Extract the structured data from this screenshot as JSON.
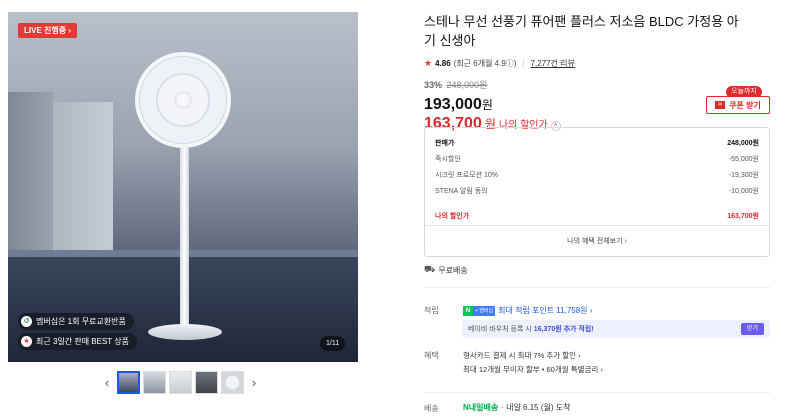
{
  "media": {
    "live_badge": "LIVE 진행중",
    "chip1": "멤버십은 1회 무료교환반품",
    "chip2": "최근 3일간 판매 BEST 상품",
    "counter": "1/11",
    "prev_arrow": "‹",
    "next_arrow": "›"
  },
  "product": {
    "title": "스테나 무선 선풍기 퓨어팬 플러스 저소음 BLDC 가정용 아기 신생아",
    "rating": "4.86",
    "rating_detail": "(최근 6개월 4.9ⓘ)",
    "reviews": "7,277건 리뷰",
    "discount_pct": "33%",
    "original_price": "248,000원",
    "price": "193,000",
    "price_unit": "원",
    "my_price": "163,700",
    "my_price_unit": "원",
    "my_price_label": "나의 할인가",
    "caret": "^"
  },
  "coupon": {
    "today_badge": "오늘까지",
    "button": "쿠폰 받기"
  },
  "breakdown": {
    "rows": [
      {
        "label": "판매가",
        "value": "248,000원"
      },
      {
        "label": "즉시할인",
        "value": "-55,000원"
      },
      {
        "label": "시크릿 프로모션 10%",
        "value": "-19,300원"
      },
      {
        "label": "STENA 알림 동의",
        "value": "-10,000원"
      }
    ],
    "total_label": "나의 할인가",
    "total_value": "163,700원",
    "footer": "나의 혜택 전체보기 ›"
  },
  "shipping": {
    "label": "무료배송"
  },
  "points": {
    "label": "적립",
    "text": "최대 적립 포인트 11,758원 ›",
    "promo_text_a": "베이비 바우처 등록 시",
    "promo_text_b": "16,370원 추가 적립!",
    "promo_button": "받기"
  },
  "benefits": {
    "label": "혜택",
    "line1": "형사카드 결제 시 최대 7% 추가 할인 ›",
    "line2": "최대 12개월 무이자 할부 • 60개월 특별금리 ›"
  },
  "delivery": {
    "label": "배송",
    "service": "N내일배송",
    "text": "· 내일 6.15 (월) 도착"
  },
  "colors": {
    "accent_red": "#e0282d",
    "naver_green": "#03c75a",
    "link_blue": "#1e5bd8"
  }
}
